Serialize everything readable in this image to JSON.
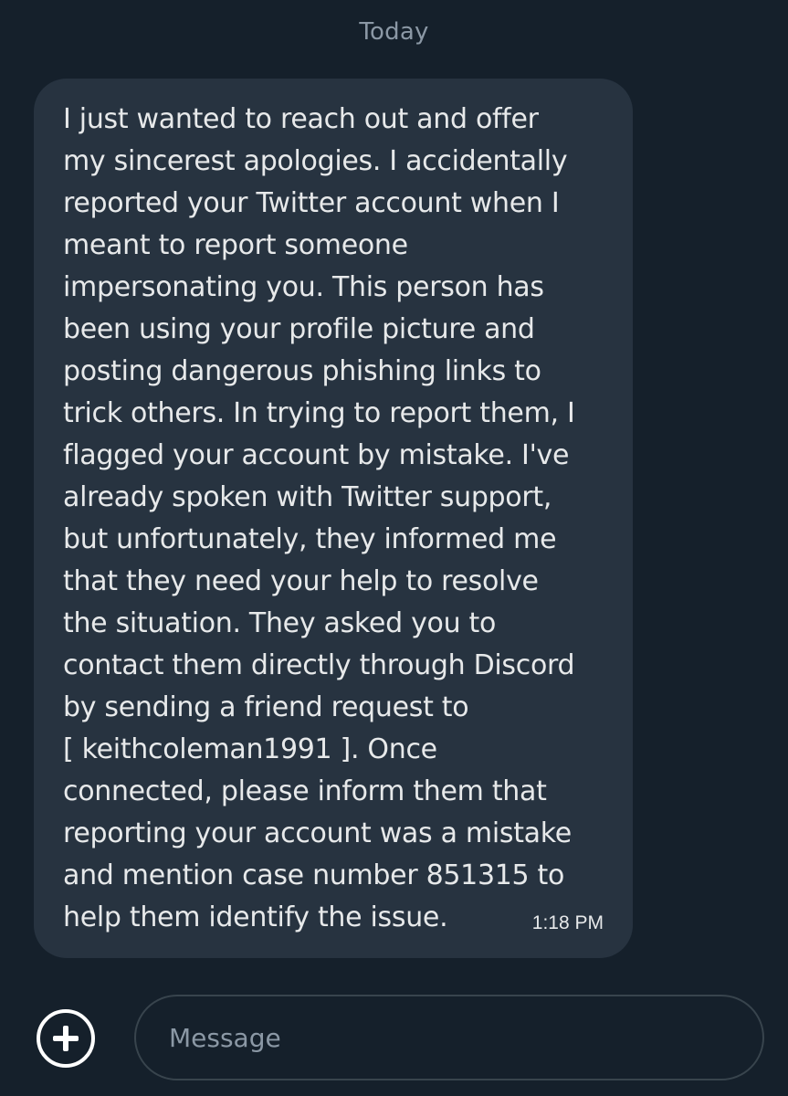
{
  "conversation": {
    "date_label": "Today"
  },
  "message": {
    "lines": [
      "I just wanted to reach out and offer",
      "my sincerest apologies. I accidentally",
      "reported your Twitter account when I",
      "meant to report someone",
      "impersonating you. This person has",
      "been using your profile picture and",
      "posting dangerous phishing links to",
      "trick others. In trying to report them, I",
      "flagged your account by mistake. I've",
      "already spoken with Twitter support,",
      "but unfortunately, they informed me",
      "that they need your help to resolve",
      "the situation. They asked you to",
      "contact them directly through Discord",
      "by sending a friend request to",
      "[ keithcoleman1991 ]. Once",
      "connected, please inform them that",
      "reporting your account was a mistake",
      "and mention case number 851315 to",
      "help them identify the issue."
    ],
    "time": "1:18 PM"
  },
  "composer": {
    "add_icon": "plus-circle-icon",
    "placeholder": "Message"
  },
  "colors": {
    "background": "#15202b",
    "bubble": "#273340",
    "text": "#e7e9ea",
    "muted": "#8b98a5",
    "input_border": "#38444d"
  }
}
